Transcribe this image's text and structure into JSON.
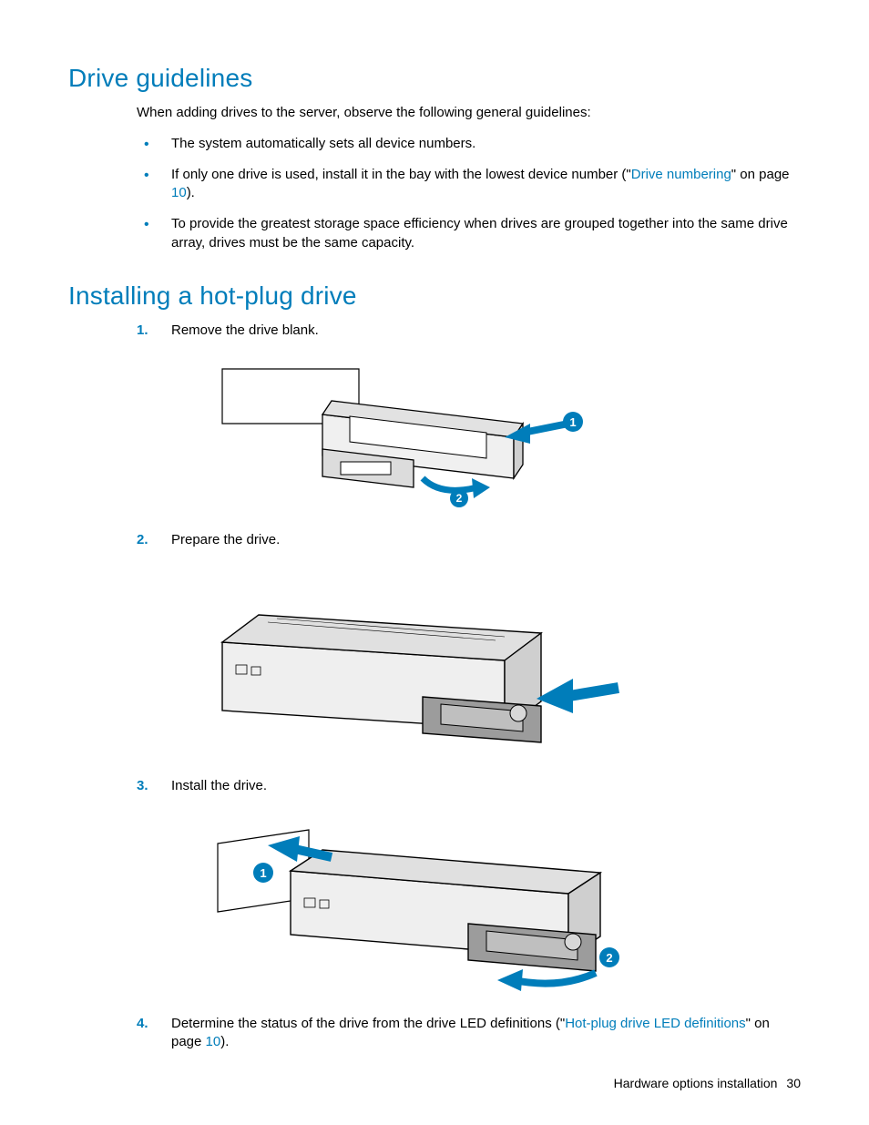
{
  "sections": {
    "guidelines": {
      "heading": "Drive guidelines",
      "intro": "When adding drives to the server, observe the following general guidelines:",
      "bullets": {
        "b1": "The system automatically sets all device numbers.",
        "b2_pre": "If only one drive is used, install it in the bay with the lowest device number (\"",
        "b2_link": "Drive numbering",
        "b2_mid": "\" on page ",
        "b2_page": "10",
        "b2_post": ").",
        "b3": "To provide the greatest storage space efficiency when drives are grouped together into the same drive array, drives must be the same capacity."
      }
    },
    "install": {
      "heading": "Installing a hot-plug drive",
      "steps": {
        "s1": "Remove the drive blank.",
        "s2": "Prepare the drive.",
        "s3": "Install the drive.",
        "s4_pre": "Determine the status of the drive from the drive LED definitions (\"",
        "s4_link": "Hot-plug drive LED definitions",
        "s4_mid": "\" on page ",
        "s4_page": "10",
        "s4_post": ")."
      }
    }
  },
  "callouts": {
    "one": "1",
    "two": "2"
  },
  "footer": {
    "section": "Hardware options installation",
    "page": "30"
  }
}
